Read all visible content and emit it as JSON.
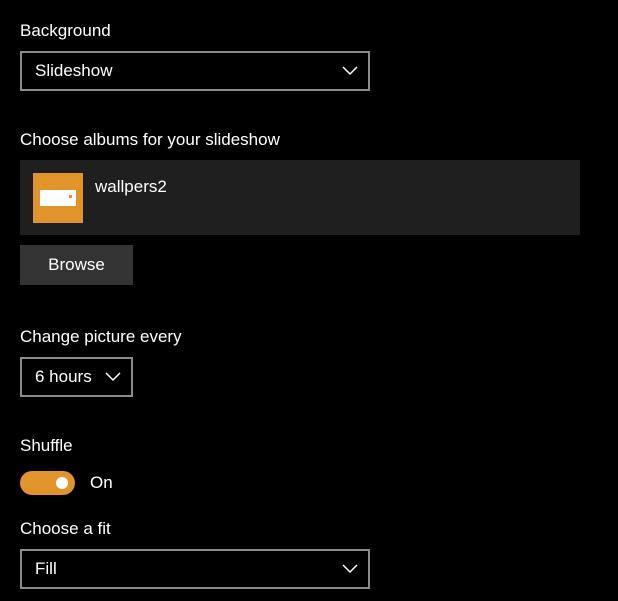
{
  "background": {
    "label": "Background",
    "selected": "Slideshow"
  },
  "albums": {
    "label": "Choose albums for your slideshow",
    "items": [
      {
        "name": "wallpers2",
        "icon": "folder-icon",
        "color": "#e1932c"
      }
    ],
    "browse_label": "Browse"
  },
  "interval": {
    "label": "Change picture every",
    "selected": "6 hours"
  },
  "shuffle": {
    "label": "Shuffle",
    "state": "On",
    "enabled": true,
    "accent": "#e1932c"
  },
  "fit": {
    "label": "Choose a fit",
    "selected": "Fill"
  }
}
